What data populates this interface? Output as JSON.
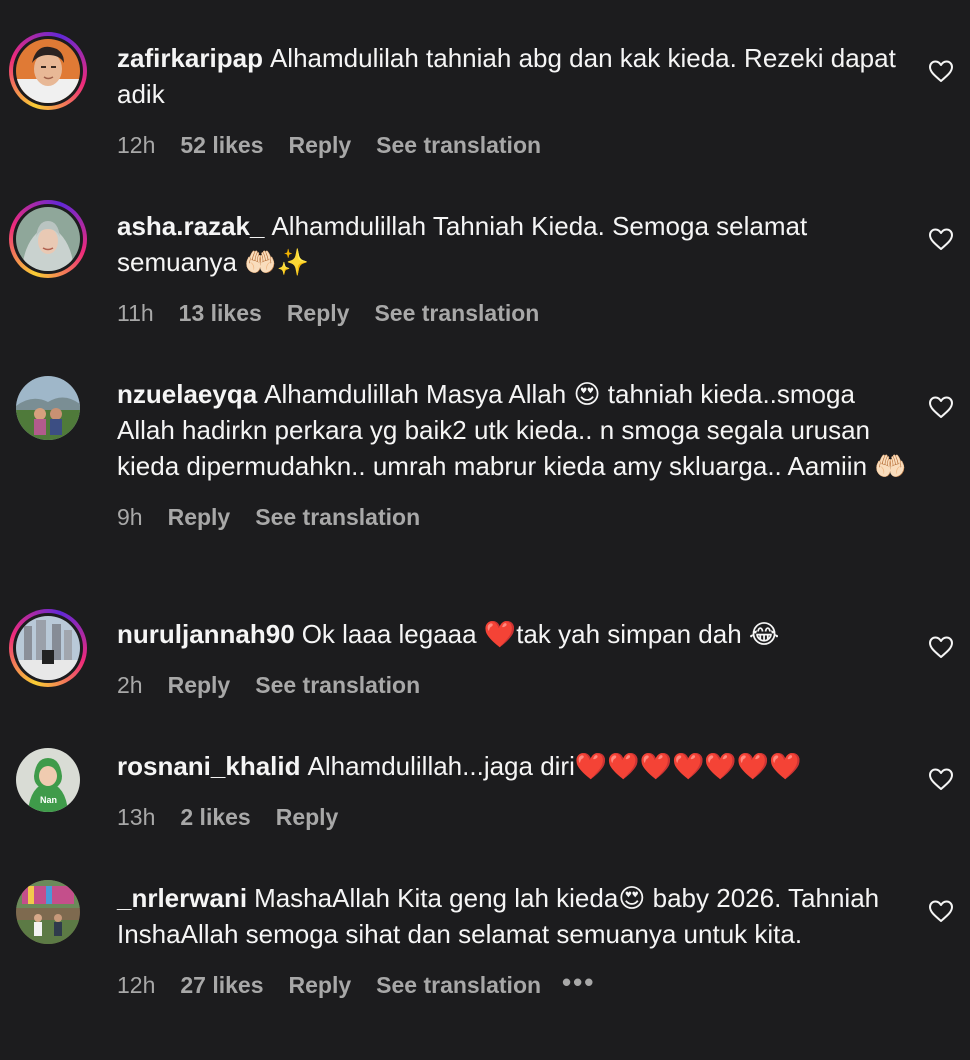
{
  "comments": [
    {
      "username": "zafirkaripap",
      "text": "Alhamdulilah tahniah abg dan kak kieda. Rezeki dapat adik",
      "time": "12h",
      "likes": "52 likes",
      "reply": "Reply",
      "translate": "See translation"
    },
    {
      "username": "asha.razak_",
      "text": "Alhamdulillah Tahniah Kieda. Semoga selamat semuanya 🤲🏻✨",
      "time": "11h",
      "likes": "13 likes",
      "reply": "Reply",
      "translate": "See translation"
    },
    {
      "username": "nzuelaeyqa",
      "text": "Alhamdulillah Masya Allah 😍 tahniah kieda..smoga Allah hadirkn perkara yg baik2 utk kieda.. n smoga segala urusan kieda dipermudahkn.. umrah mabrur kieda amy skluarga.. Aamiin 🤲🏻",
      "time": "9h",
      "reply": "Reply",
      "translate": "See translation"
    },
    {
      "username": "nuruljannah90",
      "text": "Ok laaa legaaa ❤️tak yah simpan dah 😂",
      "time": "2h",
      "reply": "Reply",
      "translate": "See translation"
    },
    {
      "username": "rosnani_khalid",
      "text": "Alhamdulillah...jaga diri❤️❤️❤️❤️❤️❤️❤️",
      "time": "13h",
      "likes": "2 likes",
      "reply": "Reply"
    },
    {
      "username": "_nrlerwani",
      "text": "MashaAllah Kita geng lah kieda😍 baby 2026. Tahniah InshaAllah semoga sihat dan selamat semuanya untuk kita.",
      "time": "12h",
      "likes": "27 likes",
      "reply": "Reply",
      "translate": "See translation",
      "more": "•••"
    }
  ],
  "icons": {
    "like": "heart-outline-icon",
    "more": "more-options-icon"
  },
  "colors": {
    "background": "#1c1c1e",
    "text": "#f5f5f5",
    "secondary": "#a8a8a8",
    "story_ring": "#ee2a7b"
  }
}
